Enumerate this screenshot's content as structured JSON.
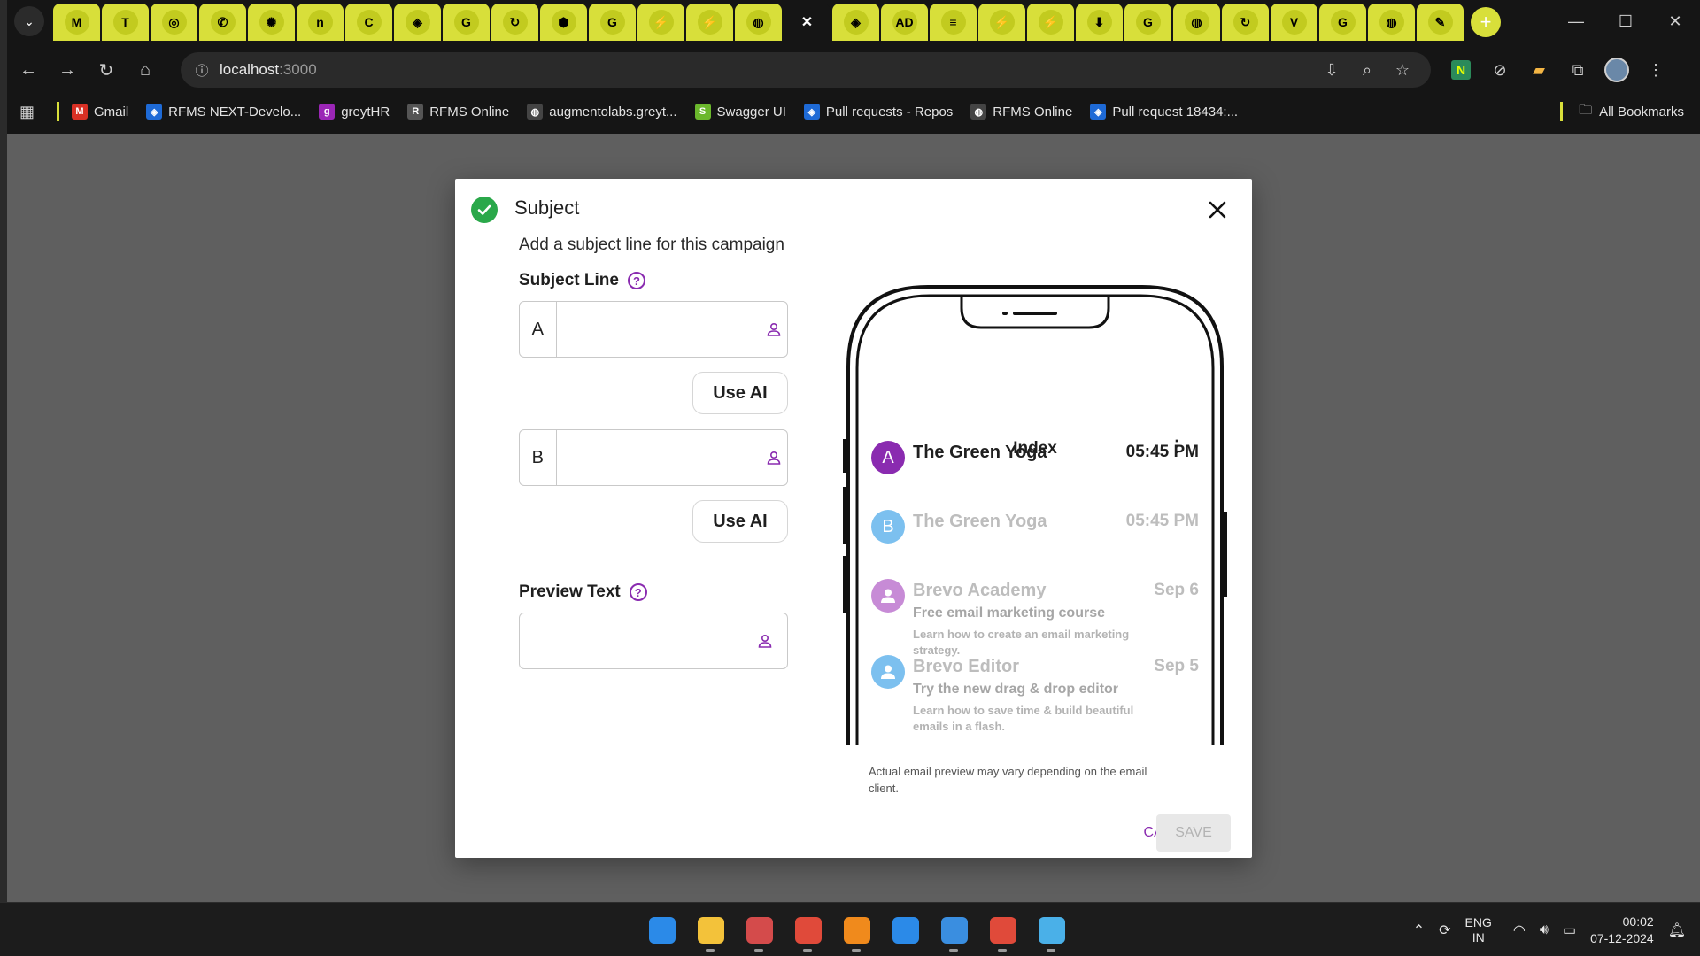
{
  "browser": {
    "tabs": [
      {
        "icon": "gmail-icon",
        "glyph": "M"
      },
      {
        "icon": "teams-icon",
        "glyph": "T"
      },
      {
        "icon": "github-icon",
        "glyph": "◎"
      },
      {
        "icon": "whatsapp-icon",
        "glyph": "✆"
      },
      {
        "icon": "chatgpt-icon",
        "glyph": "✺"
      },
      {
        "icon": "n-icon",
        "glyph": "n"
      },
      {
        "icon": "c-icon",
        "glyph": "C"
      },
      {
        "icon": "azure-devops-icon",
        "glyph": "◈"
      },
      {
        "icon": "google-icon",
        "glyph": "G"
      },
      {
        "icon": "ext-red-icon",
        "glyph": "↻"
      },
      {
        "icon": "hex-icon",
        "glyph": "⬢"
      },
      {
        "icon": "google-icon",
        "glyph": "G"
      },
      {
        "icon": "lightning-icon",
        "glyph": "⚡"
      },
      {
        "icon": "lightning-icon",
        "glyph": "⚡"
      },
      {
        "icon": "globe-icon",
        "glyph": "◍"
      },
      {
        "icon": "close-icon",
        "glyph": "✕",
        "active": true
      },
      {
        "icon": "azure-devops-icon",
        "glyph": "◈"
      },
      {
        "icon": "ad-icon",
        "glyph": "AD"
      },
      {
        "icon": "layers-icon",
        "glyph": "≡"
      },
      {
        "icon": "lightning-icon",
        "glyph": "⚡"
      },
      {
        "icon": "lightning-icon",
        "glyph": "⚡"
      },
      {
        "icon": "download-icon",
        "glyph": "⬇"
      },
      {
        "icon": "google-icon",
        "glyph": "G"
      },
      {
        "icon": "globe-icon",
        "glyph": "◍"
      },
      {
        "icon": "ext-red-icon",
        "glyph": "↻"
      },
      {
        "icon": "v-icon",
        "glyph": "V"
      },
      {
        "icon": "google-icon",
        "glyph": "G"
      },
      {
        "icon": "globe-icon",
        "glyph": "◍"
      },
      {
        "icon": "tool-icon",
        "glyph": "✎"
      }
    ],
    "new_tab": "+",
    "url_host": "localhost",
    "url_port": ":3000",
    "bookmarks": [
      {
        "label": "Gmail",
        "color": "#d93025",
        "glyph": "M"
      },
      {
        "label": "RFMS NEXT-Develo...",
        "color": "#1e6ad6",
        "glyph": "◈"
      },
      {
        "label": "greytHR",
        "color": "#9b26b6",
        "glyph": "g"
      },
      {
        "label": "RFMS Online",
        "color": "#555555",
        "glyph": "R"
      },
      {
        "label": "augmentolabs.greyt...",
        "color": "#444444",
        "glyph": "◍"
      },
      {
        "label": "Swagger UI",
        "color": "#6bb82c",
        "glyph": "S"
      },
      {
        "label": "Pull requests - Repos",
        "color": "#1e6ad6",
        "glyph": "◈"
      },
      {
        "label": "RFMS Online",
        "color": "#444444",
        "glyph": "◍"
      },
      {
        "label": "Pull request 18434:...",
        "color": "#1e6ad6",
        "glyph": "◈"
      }
    ],
    "all_bookmarks": "All Bookmarks"
  },
  "modal": {
    "title": "Subject",
    "subtitle": "Add a subject line for this campaign",
    "subject_line_label": "Subject Line",
    "variant_a_prefix": "A",
    "variant_a_value": "",
    "variant_b_prefix": "B",
    "variant_b_value": "",
    "use_ai_label": "Use AI",
    "preview_text_label": "Preview Text",
    "preview_text_value": "",
    "help_glyph": "?",
    "disclaimer": "Actual email preview may vary depending on the email client.",
    "cancel_label": "CANCEL",
    "save_label": "SAVE",
    "accent_color": "#8a2bb0"
  },
  "phone": {
    "title": "Index",
    "emails": [
      {
        "avatar": "A",
        "from": "The Green Yoga",
        "time": "05:45 PM",
        "avatar_color": "#8a2bb0",
        "from_color": "#1f1f1f"
      },
      {
        "avatar": "B",
        "from": "The Green Yoga",
        "time": "05:45 PM",
        "avatar_color": "#7cc0ef",
        "from_color": "#bdbdbd"
      },
      {
        "avatar": "person-icon",
        "from": "Brevo Academy",
        "time": "Sep 6",
        "subject": "Free email marketing course",
        "snippet": "Learn how to create an email marketing strategy.",
        "avatar_color": "#c78bd6",
        "from_color": "#bdbdbd"
      },
      {
        "avatar": "person-icon",
        "from": "Brevo Editor",
        "time": "Sep 5",
        "subject": "Try the new drag & drop editor",
        "snippet": "Learn how to save time & build beautiful emails in a flash.",
        "avatar_color": "#7cc0ef",
        "from_color": "#bdbdbd"
      }
    ]
  },
  "taskbar": {
    "apps": [
      {
        "icon": "windows-start-icon",
        "color": "#2b8ae8"
      },
      {
        "icon": "file-explorer-icon",
        "color": "#f3c23a"
      },
      {
        "icon": "snipping-tool-icon",
        "color": "#d44b4b"
      },
      {
        "icon": "chrome-icon",
        "color": "#e04a3a"
      },
      {
        "icon": "vlc-icon",
        "color": "#f08a1c"
      },
      {
        "icon": "vscode-icon",
        "color": "#2b8ae8"
      },
      {
        "icon": "photos-icon",
        "color": "#3a8ee0"
      },
      {
        "icon": "chrome-icon",
        "color": "#e04a3a"
      },
      {
        "icon": "paint-icon",
        "color": "#4ab0e8"
      }
    ],
    "lang_line1": "ENG",
    "lang_line2": "IN",
    "time": "00:02",
    "date": "07-12-2024"
  }
}
